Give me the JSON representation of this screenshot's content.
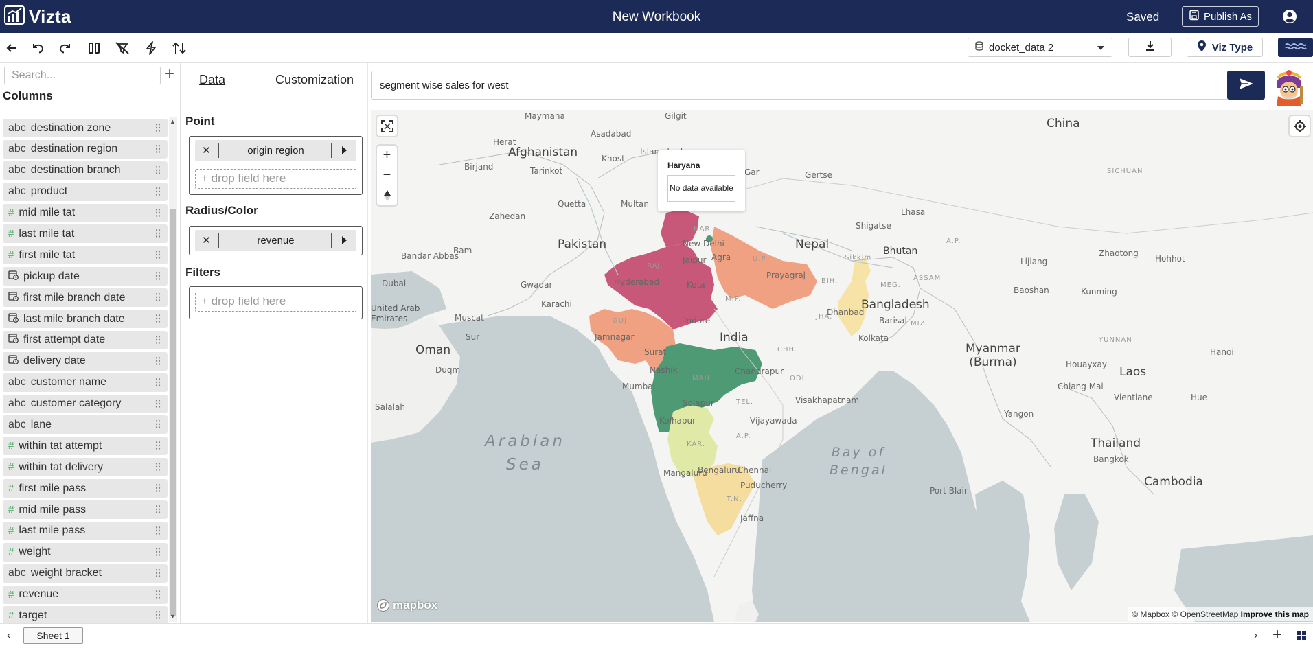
{
  "app": {
    "logo_text": "Vizta",
    "workbook_title": "New Workbook",
    "save_status": "Saved",
    "publish_label": "Publish As"
  },
  "toolbar": {
    "dataset": "docket_data 2",
    "viz_type_label": "Viz Type",
    "icons": [
      "back-arrow-icon",
      "undo-icon",
      "redo-icon",
      "columns-icon",
      "clear-icon",
      "lightning-icon",
      "sort-icon"
    ]
  },
  "columns_panel": {
    "search_placeholder": "Search...",
    "title": "Columns",
    "items": [
      {
        "type": "abc",
        "name": "destination zone"
      },
      {
        "type": "abc",
        "name": "destination region"
      },
      {
        "type": "abc",
        "name": "destination branch"
      },
      {
        "type": "abc",
        "name": "product"
      },
      {
        "type": "#",
        "name": "mid mile tat"
      },
      {
        "type": "#",
        "name": "last mile tat"
      },
      {
        "type": "#",
        "name": "first mile tat"
      },
      {
        "type": "date",
        "name": "pickup date"
      },
      {
        "type": "date",
        "name": "first mile branch date"
      },
      {
        "type": "date",
        "name": "last mile branch date"
      },
      {
        "type": "date",
        "name": "first attempt date"
      },
      {
        "type": "date",
        "name": "delivery date"
      },
      {
        "type": "abc",
        "name": "customer name"
      },
      {
        "type": "abc",
        "name": "customer category"
      },
      {
        "type": "abc",
        "name": "lane"
      },
      {
        "type": "#",
        "name": "within tat attempt"
      },
      {
        "type": "#",
        "name": "within tat delivery"
      },
      {
        "type": "#",
        "name": "first mile pass"
      },
      {
        "type": "#",
        "name": "mid mile pass"
      },
      {
        "type": "#",
        "name": "last mile pass"
      },
      {
        "type": "#",
        "name": "weight"
      },
      {
        "type": "abc",
        "name": "weight bracket"
      },
      {
        "type": "#",
        "name": "revenue"
      },
      {
        "type": "#",
        "name": "target"
      }
    ]
  },
  "config_panel": {
    "tabs": {
      "data": "Data",
      "customization": "Customization"
    },
    "point": {
      "title": "Point",
      "field": "origin region",
      "drop": "drop field here"
    },
    "radius_color": {
      "title": "Radius/Color",
      "field": "revenue"
    },
    "filters": {
      "title": "Filters",
      "drop": "drop field here"
    }
  },
  "query": {
    "text": "segment wise sales for west"
  },
  "map": {
    "tooltip": {
      "title": "Haryana",
      "message": "No data available"
    },
    "labels": {
      "countries": [
        "Afghanistan",
        "Pakistan",
        "Nepal",
        "Bhutan",
        "Bangladesh",
        "India",
        "Oman",
        "Myanmar\n(Burma)",
        "Laos",
        "Thailand",
        "Cambodia",
        "China",
        "United Arab\nEmirates"
      ],
      "seas": [
        "Arabian\nSea",
        "Bay of\nBengal"
      ],
      "cities": [
        "Maymana",
        "Gilgit",
        "Herat",
        "Asadabad",
        "Khost",
        "Islamabad",
        "Birjand",
        "Tarinkot",
        "Quetta",
        "Multan",
        "Zahedan",
        "Bam",
        "Bandar Abbas",
        "Dubai",
        "Hyderabad",
        "Gwadar",
        "Karachi",
        "Muscat",
        "Sur",
        "Duqm",
        "Salalah",
        "New Delhi",
        "Jaipur",
        "Agra",
        "Kota",
        "Prayagraj",
        "Indore",
        "Dhanbad",
        "Kolkata",
        "Barisal",
        "Jamnagar",
        "Surat",
        "Nashik",
        "Mumbai",
        "Chandrapur",
        "Solapur",
        "Kolhapur",
        "Visakhapatnam",
        "Vijayawada",
        "Bengaluru",
        "Chennai",
        "Mangaluru",
        "Puducherry",
        "Jaffna",
        "Sikkim",
        "Shigatse",
        "Lhasa",
        "Gertse",
        "Gar",
        "Lijiang",
        "Zhaotong",
        "Baoshan",
        "Kunming",
        "Yangon",
        "Chiang Mai",
        "Vientiane",
        "Hanoi",
        "Bangkok",
        "Port Blair",
        "Hohhot",
        "Houayxay",
        "Hue"
      ],
      "states": [
        "RAJ.",
        "HAR.",
        "U.P.",
        "GUJ.",
        "M.P.",
        "MAH.",
        "TEL.",
        "A.P.",
        "KAR.",
        "T.N.",
        "BIH.",
        "JHA.",
        "CHH.",
        "ODI.",
        "MEG.",
        "ASSAM",
        "MIZ.",
        "A.P.",
        "SICHUAN",
        "YUNNAN"
      ]
    },
    "attribution": {
      "mapbox": "© Mapbox",
      "osm": "© OpenStreetMap",
      "improve": "Improve this map"
    },
    "logo_text": "mapbox",
    "region_colors": {
      "west_high": "#c8587a",
      "west_mid": "#f0a182",
      "central_low": "#4e9a74",
      "south_light": "#e0eaa6",
      "south_yellow": "#f5dc9f",
      "east_yellow": "#f7e3a5"
    }
  },
  "bottom": {
    "sheet_tab": "Sheet 1"
  }
}
